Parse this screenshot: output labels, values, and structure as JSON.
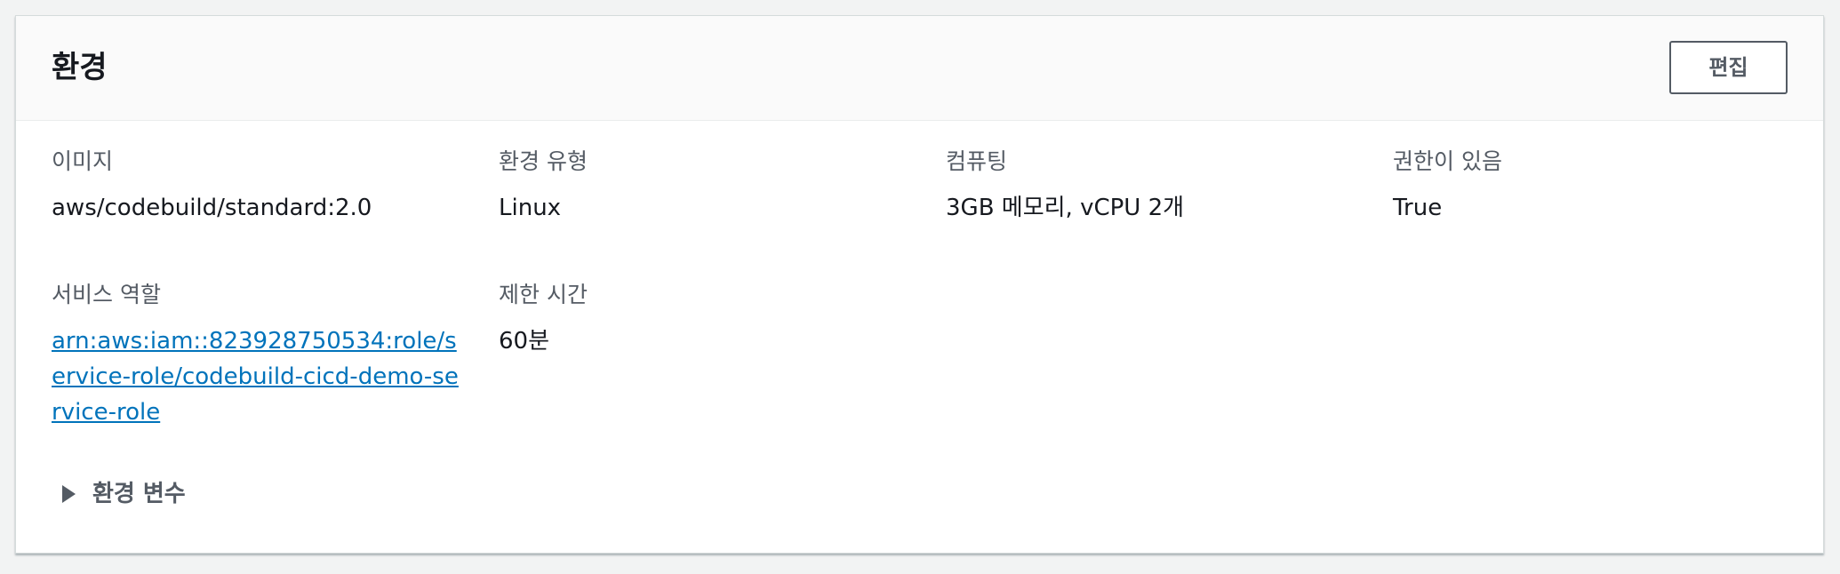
{
  "panel": {
    "title": "환경",
    "edit_label": "편집"
  },
  "fields": {
    "image": {
      "label": "이미지",
      "value": "aws/codebuild/standard:2.0"
    },
    "environment_type": {
      "label": "환경 유형",
      "value": "Linux"
    },
    "compute": {
      "label": "컴퓨팅",
      "value": "3GB 메모리, vCPU 2개"
    },
    "privileged": {
      "label": "권한이 있음",
      "value": "True"
    },
    "service_role": {
      "label": "서비스 역할",
      "value": "arn:aws:iam::823928750534:role/service-role/codebuild-cicd-demo-service-role"
    },
    "timeout": {
      "label": "제한 시간",
      "value": "60분"
    }
  },
  "env_vars": {
    "label": "환경 변수",
    "expanded": false
  }
}
